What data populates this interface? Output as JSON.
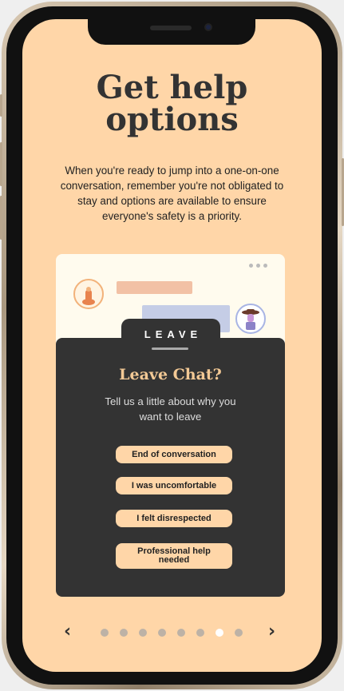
{
  "header": {
    "title_line1": "Get help",
    "title_line2": "options",
    "description": "When you're ready to jump into a one-on-one conversation, remember you're not obligated to stay and options are available to ensure everyone's safety is a priority."
  },
  "modal": {
    "tab_label": "LEAVE",
    "title": "Leave Chat?",
    "subtitle": "Tell us a little about why you want to leave",
    "options": [
      "End of conversation",
      "I was uncomfortable",
      "I felt disrespected",
      "Professional help needed"
    ]
  },
  "pager": {
    "prev_icon": "‹",
    "next_icon": "›",
    "total_pages": 8,
    "active_page": 7
  },
  "colors": {
    "screen_bg": "#ffd6a8",
    "sheet_bg": "#333333",
    "accent": "#f3c995"
  }
}
